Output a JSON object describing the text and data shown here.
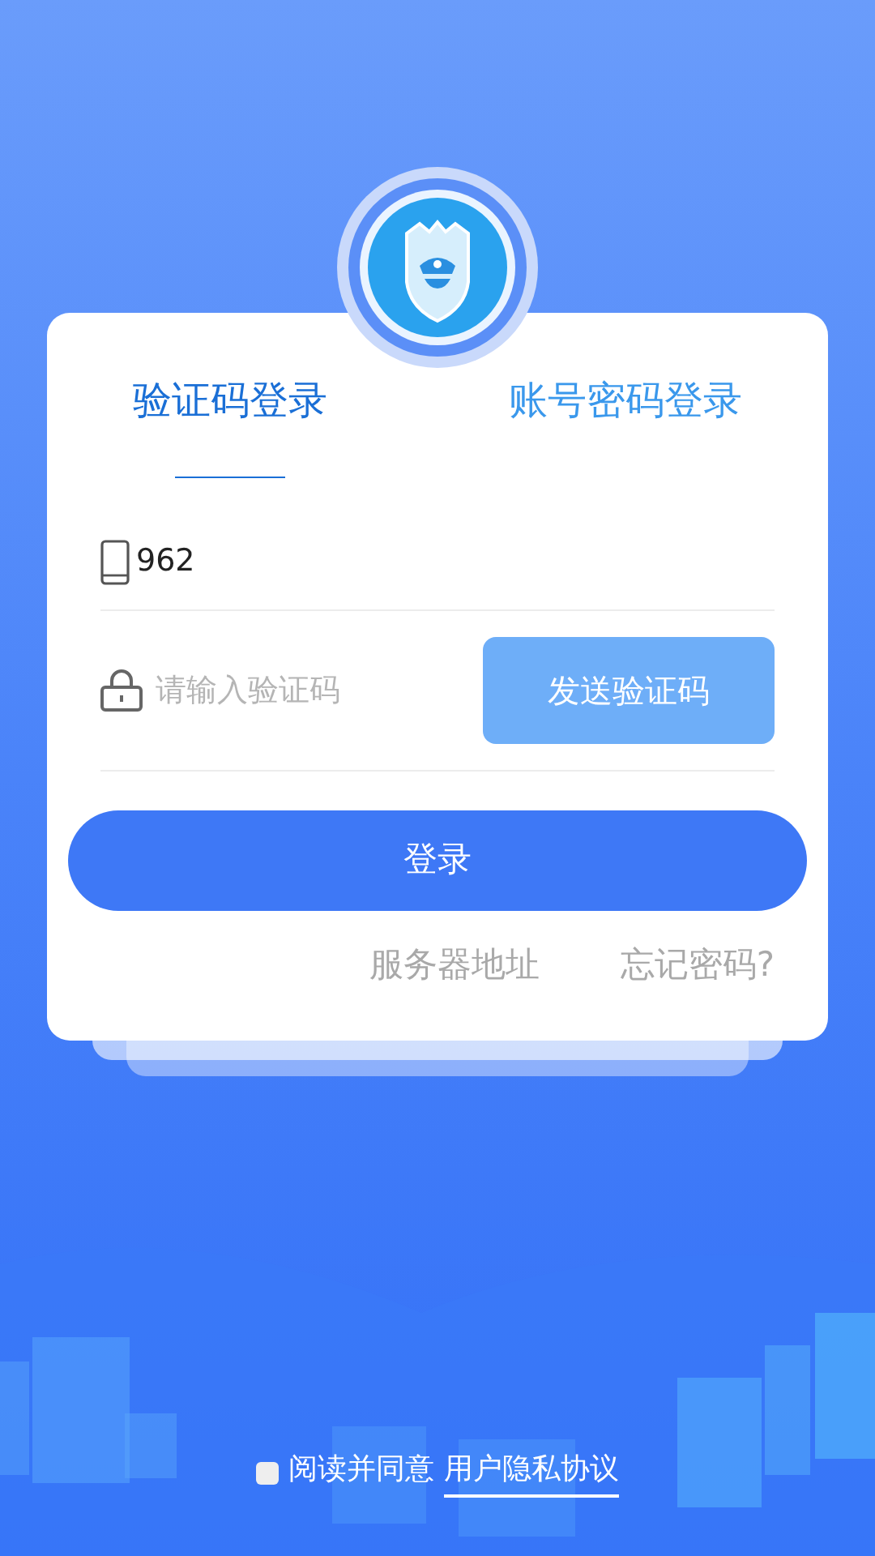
{
  "tabs": [
    {
      "label": "验证码登录",
      "selected": true
    },
    {
      "label": "账号密码登录",
      "selected": false
    }
  ],
  "phone_field": {
    "value": "962"
  },
  "code_field": {
    "placeholder": "请输入验证码"
  },
  "send_code_button": "发送验证码",
  "login_button": "登录",
  "links": [
    "服务器地址",
    "忘记密码?"
  ],
  "agreement": {
    "checked": false,
    "text": "阅读并同意",
    "link": "用户隐私协议"
  }
}
